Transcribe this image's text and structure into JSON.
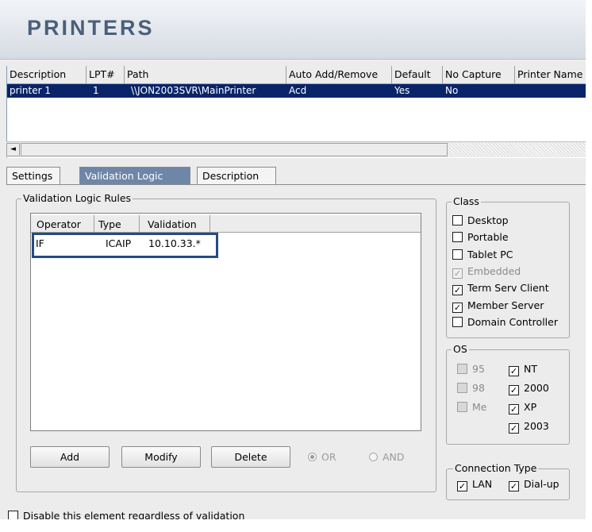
{
  "banner": {
    "title": "PRINTERS"
  },
  "printers": {
    "columns": [
      "Description",
      "LPT#",
      "Path",
      "Auto Add/Remove",
      "Default",
      "No Capture",
      "Printer Name"
    ],
    "rows": [
      [
        "printer 1",
        "1",
        "\\\\JON2003SVR\\MainPrinter",
        "Acd",
        "Yes",
        "No",
        ""
      ]
    ]
  },
  "scroll": {
    "left_arrow": "◄"
  },
  "tabs": [
    "Settings",
    "Validation Logic",
    "Description"
  ],
  "rules": {
    "group_label": "Validation Logic Rules",
    "columns": [
      "Operator",
      "Type",
      "Validation"
    ],
    "rows": [
      [
        "IF",
        "ICAIP",
        "10.10.33.*"
      ]
    ],
    "buttons": {
      "add": "Add",
      "modify": "Modify",
      "delete": "Delete"
    },
    "radio": {
      "or": "OR",
      "and": "AND"
    }
  },
  "class_group": {
    "label": "Class",
    "items": [
      {
        "label": "Desktop",
        "state": "unchecked"
      },
      {
        "label": "Portable",
        "state": "unchecked"
      },
      {
        "label": "Tablet PC",
        "state": "unchecked"
      },
      {
        "label": "Embedded",
        "state": "checked-disabled"
      },
      {
        "label": "Term Serv Client",
        "state": "checked"
      },
      {
        "label": "Member Server",
        "state": "checked"
      },
      {
        "label": "Domain Controller",
        "state": "unchecked"
      }
    ]
  },
  "os_group": {
    "label": "OS",
    "items": [
      {
        "label": "95",
        "state": "disabled"
      },
      {
        "label": "NT",
        "state": "checked"
      },
      {
        "label": "98",
        "state": "disabled"
      },
      {
        "label": "2000",
        "state": "checked"
      },
      {
        "label": "Me",
        "state": "disabled"
      },
      {
        "label": "XP",
        "state": "checked"
      },
      {
        "label": "2003",
        "state": "checked"
      }
    ]
  },
  "connection_group": {
    "label": "Connection Type",
    "items": [
      {
        "label": "LAN",
        "state": "checked"
      },
      {
        "label": "Dial-up",
        "state": "checked"
      }
    ]
  },
  "footer": {
    "disable_label": "Disable this element regardless of validation"
  },
  "check_mark": "✓"
}
